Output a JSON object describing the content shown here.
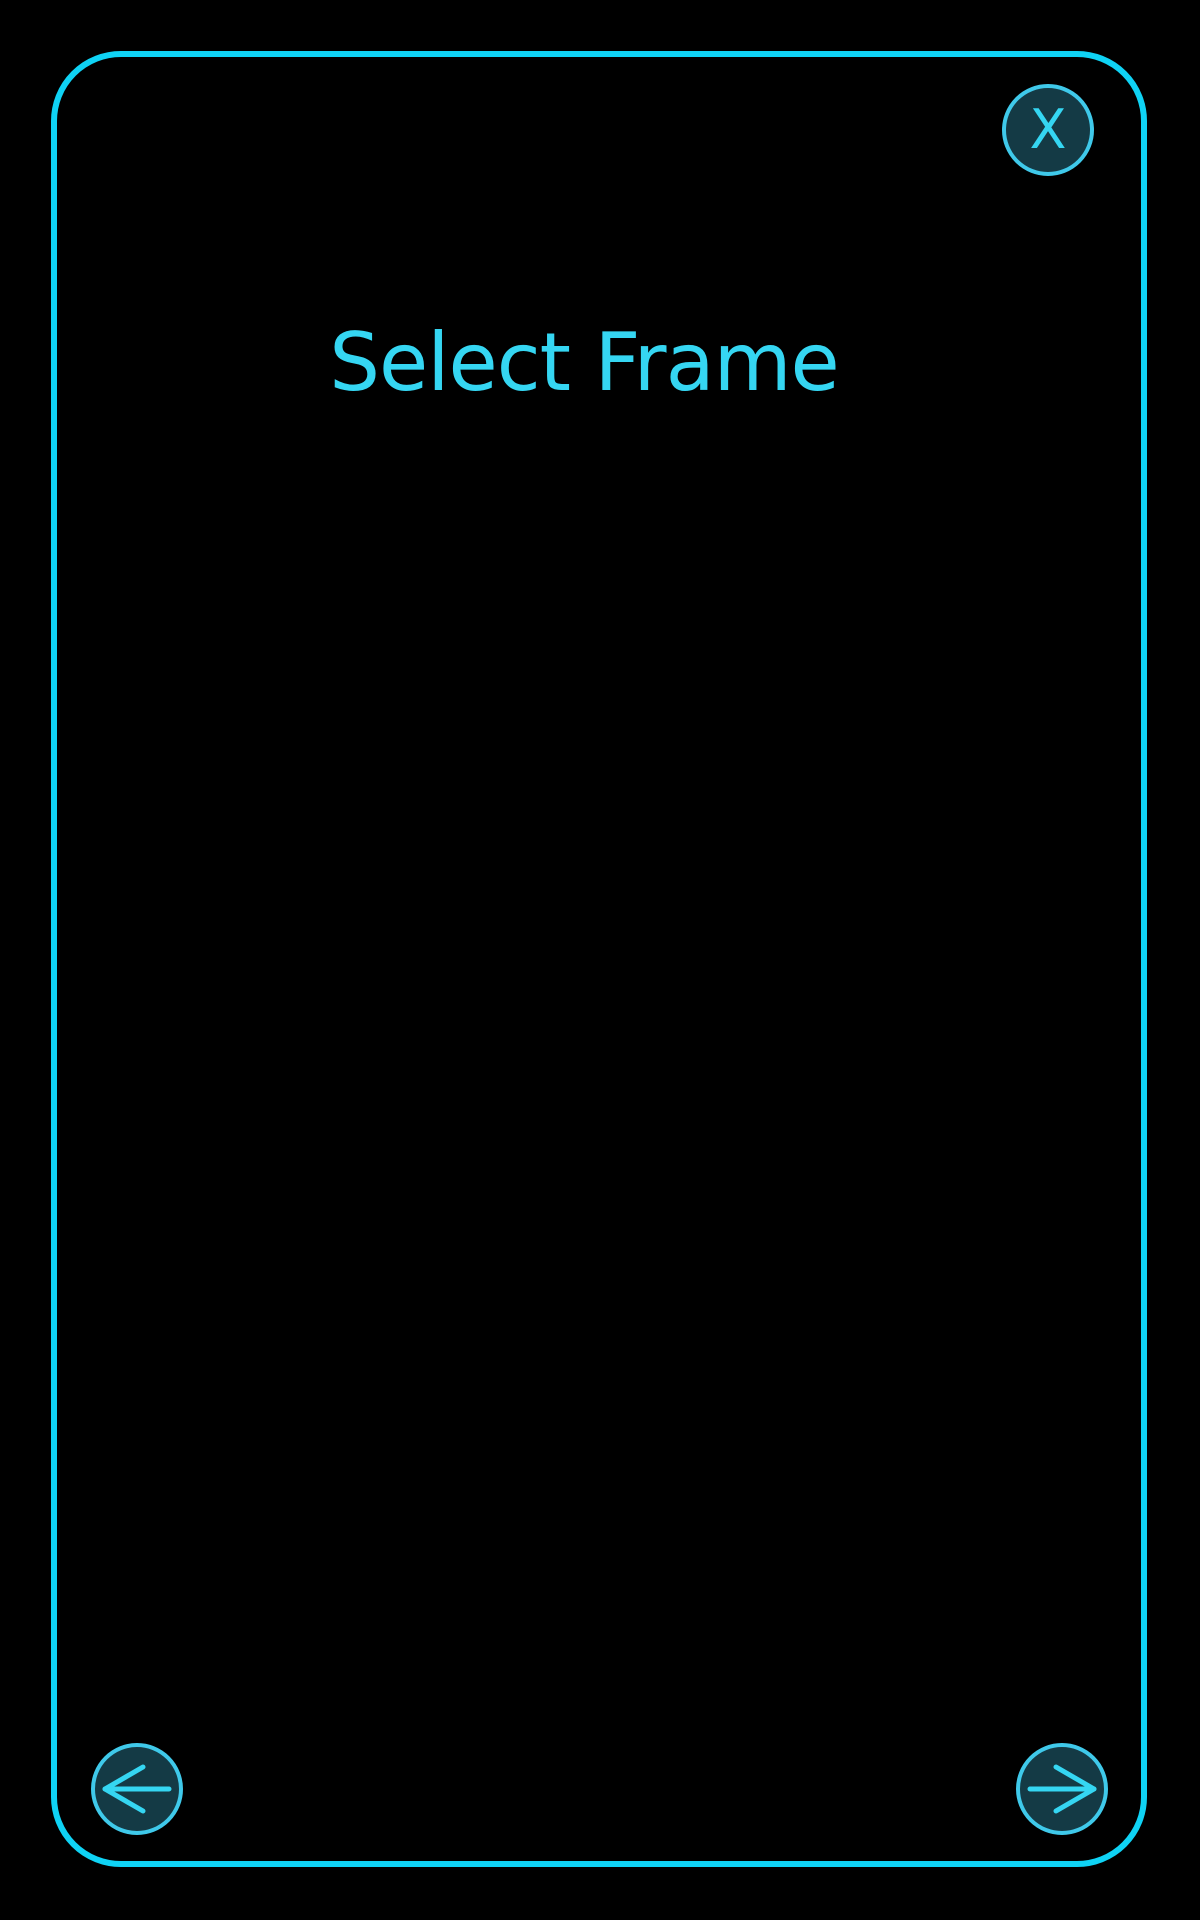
{
  "dialog": {
    "title": "Select Frame",
    "close_label": "X"
  },
  "navigation": {
    "prev_icon": "arrow-left-icon",
    "next_icon": "arrow-right-icon"
  },
  "colors": {
    "background": "#000000",
    "accent_border": "#0fd3f5",
    "accent_text": "#35d6f2",
    "button_fill": "#143a45"
  }
}
